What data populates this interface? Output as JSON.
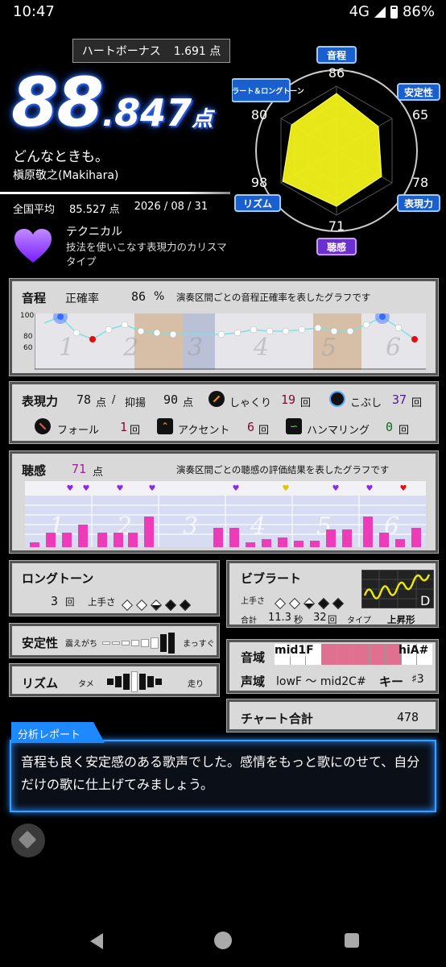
{
  "status": {
    "time": "10:47",
    "network": "4G",
    "battery": "86%"
  },
  "heart_bonus": {
    "label": "ハートボーナス",
    "value": "1.691 点"
  },
  "score": {
    "int": "88",
    "dot": ".",
    "dec": "847",
    "unit": "点"
  },
  "song": {
    "title": "どんなときも。",
    "artist": "槇原敬之(Makihara)"
  },
  "average": {
    "label": "全国平均",
    "value": "85.527 点",
    "date": "2026 / 08 / 31"
  },
  "type": {
    "title": "テクニカル",
    "desc": "技法を使いこなす表現力のカリスマタイプ"
  },
  "radar": {
    "labels": {
      "pitch": "音程",
      "stability": "安定性",
      "expression": "表現力",
      "listening": "聴感",
      "rhythm": "リズム",
      "vibrato": "ビブラート＆ロングトーン"
    },
    "values": {
      "pitch": "86",
      "stability": "65",
      "expression": "78",
      "listening": "71",
      "rhythm": "98",
      "vibrato": "80"
    }
  },
  "pitch_panel": {
    "label": "音程",
    "rate_label": "正確率",
    "rate": "86",
    "unit": "%",
    "desc": "演奏区間ごとの音程正確率を表したグラフです",
    "y_ticks": [
      "100",
      "80",
      "60"
    ],
    "sections": [
      "1",
      "2",
      "3",
      "4",
      "5",
      "6"
    ]
  },
  "expr_panel": {
    "label": "表現力",
    "score": "78",
    "score_unit": "点",
    "yokuyo_label": "抑揚",
    "yokuyo": "90",
    "yokuyo_unit": "点",
    "shakuri_label": "しゃくり",
    "shakuri": "19",
    "kobushi_label": "こぶし",
    "kobushi": "37",
    "fall_label": "フォール",
    "fall": "1",
    "accent_label": "アクセント",
    "accent": "6",
    "hammer_label": "ハンマリング",
    "hammer": "0",
    "times": "回",
    "slash": "/"
  },
  "listen_panel": {
    "label": "聴感",
    "score": "71",
    "unit": "点",
    "desc": "演奏区間ごとの聴感の評価結果を表したグラフです",
    "sections": [
      "1",
      "2",
      "3",
      "4",
      "5",
      "6"
    ]
  },
  "longtone": {
    "label": "ロングトーン",
    "count": "3",
    "count_unit": "回",
    "skill_label": "上手さ"
  },
  "stability": {
    "label": "安定性",
    "left": "震えがち",
    "right": "まっすぐ"
  },
  "rhythm": {
    "label": "リズム",
    "left": "タメ",
    "right": "走り"
  },
  "vibrato": {
    "label": "ビブラート",
    "skill_label": "上手さ",
    "total_label": "合計",
    "seconds": "11.3",
    "sec_unit": "秒",
    "count": "32",
    "count_unit": "回",
    "type_label": "タイプ",
    "type": "上昇形",
    "grade": "D"
  },
  "range": {
    "label": "音域",
    "low": "mid1F",
    "high": "hiA#",
    "voice_label": "声域",
    "voice": "lowF 〜 mid2C#",
    "key_label": "キー",
    "key": "♯3"
  },
  "chart_total": {
    "label": "チャート合計",
    "value": "478"
  },
  "report": {
    "title": "分析レポート",
    "text": "音程も良く安定感のある歌声でした。感情をもっと歌にのせて、自分だけの歌に仕上げてみましょう。"
  },
  "colors": {
    "accent": "#1e88ff",
    "radar_fill": "#f2f21a",
    "panel": "#d9d9d9"
  }
}
